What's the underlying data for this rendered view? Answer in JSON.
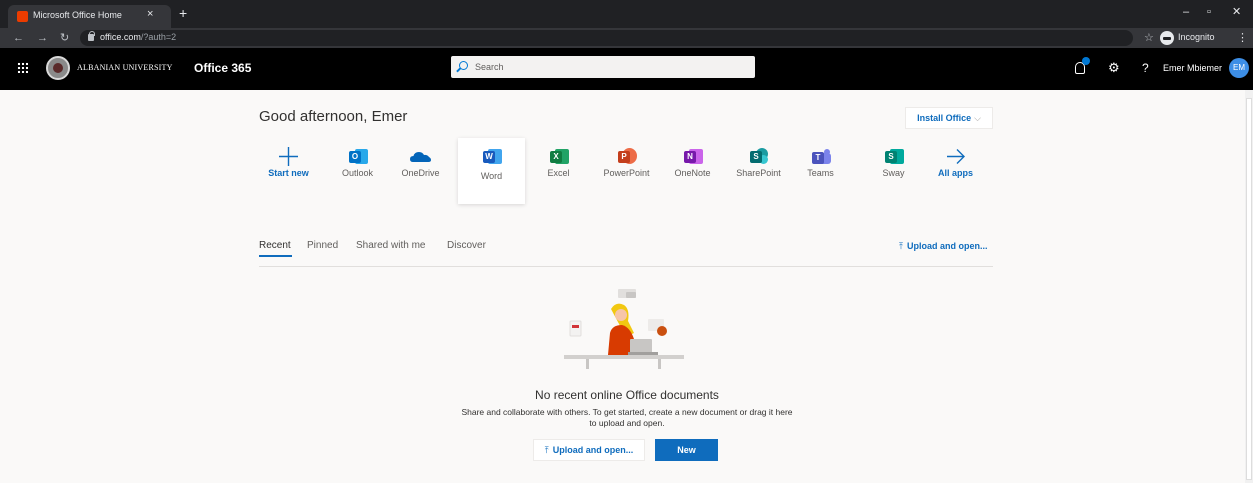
{
  "browser": {
    "tab_title": "Microsoft Office Home",
    "tab_close": "×",
    "new_tab": "+",
    "url_host": "office.com",
    "url_path": "/?auth=2",
    "incognito_label": "Incognito",
    "controls": {
      "minimize": "–",
      "restore": "▫",
      "close": "✕"
    }
  },
  "suite_header": {
    "org_name": "ALBANIAN UNIVERSITY",
    "suite_name": "Office 365",
    "search_placeholder": "Search",
    "help": "?",
    "user_name": "Emer Mbiemer",
    "avatar_initials": "EM"
  },
  "main": {
    "greeting": "Good afternoon, Emer",
    "install_office": "Install Office",
    "apps": [
      {
        "label": "Start new",
        "icon": "plus-icon"
      },
      {
        "label": "Outlook",
        "icon": "outlook-icon",
        "letter": "O",
        "color": "#0072c6"
      },
      {
        "label": "OneDrive",
        "icon": "onedrive-icon",
        "color": "#0364b8"
      },
      {
        "label": "Word",
        "icon": "word-icon",
        "letter": "W",
        "color": "#185abd"
      },
      {
        "label": "Excel",
        "icon": "excel-icon",
        "letter": "X",
        "color": "#107c41"
      },
      {
        "label": "PowerPoint",
        "icon": "powerpoint-icon",
        "letter": "P",
        "color": "#c43e1c"
      },
      {
        "label": "OneNote",
        "icon": "onenote-icon",
        "letter": "N",
        "color": "#7719aa"
      },
      {
        "label": "SharePoint",
        "icon": "sharepoint-icon",
        "letter": "S",
        "color": "#036c70"
      },
      {
        "label": "Teams",
        "icon": "teams-icon",
        "letter": "T",
        "color": "#4b53bc"
      },
      {
        "label": "Sway",
        "icon": "sway-icon",
        "letter": "S",
        "color": "#008272"
      },
      {
        "label": "All apps",
        "icon": "arrow-right-icon"
      }
    ],
    "pivots": [
      "Recent",
      "Pinned",
      "Shared with me",
      "Discover"
    ],
    "upload_open": "Upload and open...",
    "empty_title": "No recent online Office documents",
    "empty_desc_line1": "Share and collaborate with others. To get started, create a new document or drag it here",
    "empty_desc_line2": "to upload and open.",
    "btn_upload": "Upload and open...",
    "btn_new": "New"
  },
  "colors": {
    "accent": "#0f6cbd",
    "suite_bar": "#000000",
    "page_bg": "#faf9f8"
  }
}
